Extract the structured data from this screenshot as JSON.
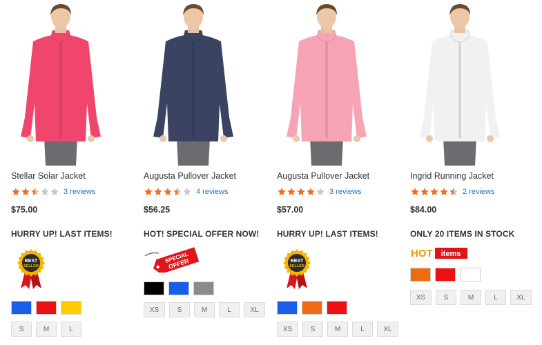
{
  "products": [
    {
      "name": "Stellar Solar Jacket",
      "rating": 2.5,
      "reviews": "3 reviews",
      "price": "$75.00",
      "promo": "HURRY UP! LAST ITEMS!",
      "badge": "best-seller",
      "badge_text": [
        "BEST",
        "SELLER"
      ],
      "jacket_color": "#f0466e",
      "colors": [
        "#1a5ee8",
        "#ee0f12",
        "#ffcc00"
      ],
      "sizes": [
        "S",
        "M",
        "L"
      ]
    },
    {
      "name": "Augusta Pullover Jacket",
      "rating": 3.5,
      "reviews": "4 reviews",
      "price": "$56.25",
      "promo": "HOT! SPECIAL OFFER NOW!",
      "badge": "special-offer",
      "badge_text": [
        "SPECIAL",
        "OFFER"
      ],
      "jacket_color": "#3a4462",
      "colors": [
        "#000000",
        "#1a5ee8",
        "#8a8a8a"
      ],
      "sizes": [
        "XS",
        "S",
        "M",
        "L",
        "XL"
      ]
    },
    {
      "name": "Augusta Pullover Jacket",
      "rating": 4,
      "reviews": "3 reviews",
      "price": "$57.00",
      "promo": "HURRY UP! LAST ITEMS!",
      "badge": "best-seller",
      "badge_text": [
        "BEST",
        "SELLER"
      ],
      "jacket_color": "#f7a3b6",
      "colors": [
        "#1a5ee8",
        "#ef6a10",
        "#ee0f12"
      ],
      "sizes": [
        "XS",
        "S",
        "M",
        "L",
        "XL"
      ]
    },
    {
      "name": "Ingrid Running Jacket",
      "rating": 4.5,
      "reviews": "2 reviews",
      "price": "$84.00",
      "promo": "ONLY 20 ITEMS IN STOCK",
      "badge": "hot-items",
      "badge_text": [
        "HOT",
        "items"
      ],
      "jacket_color": "#f1f1f1",
      "colors": [
        "#ef6a10",
        "#ee0f12",
        "#ffffff"
      ],
      "sizes": [
        "XS",
        "S",
        "M",
        "L",
        "XL"
      ]
    }
  ],
  "star_color": "#f26c1e",
  "star_empty_color": "#c8c8c8"
}
